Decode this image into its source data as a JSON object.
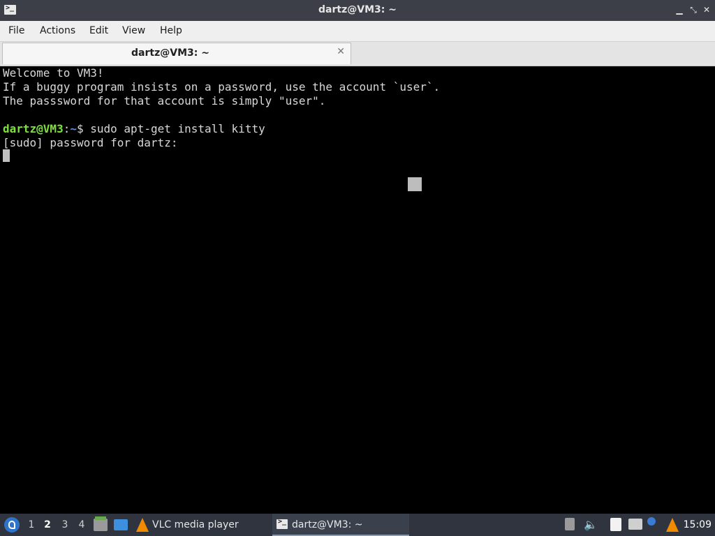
{
  "window": {
    "title": "dartz@VM3: ~",
    "minimize_glyph": "▁",
    "maximize_glyph": "⤡",
    "close_glyph": "✕"
  },
  "menu": {
    "items": [
      "File",
      "Actions",
      "Edit",
      "View",
      "Help"
    ]
  },
  "tab": {
    "label": "dartz@VM3: ~",
    "close_glyph": "✕"
  },
  "terminal": {
    "lines": [
      "Welcome to VM3!",
      "If a buggy program insists on a password, use the account `user`.",
      "The passsword for that account is simply \"user\".",
      ""
    ],
    "prompt": {
      "user_host": "dartz@VM3",
      "separator": ":",
      "path": "~",
      "symbol": "$",
      "command": " sudo apt-get install kitty"
    },
    "sudo_line": "[sudo] password for dartz:",
    "colors": {
      "background": "#000000",
      "text": "#d8d8d8",
      "prompt_user": "#7ee03a",
      "prompt_path": "#5a8ee8"
    }
  },
  "taskbar": {
    "workspaces": [
      {
        "label": "1",
        "active": false
      },
      {
        "label": "2",
        "active": true
      },
      {
        "label": "3",
        "active": false
      },
      {
        "label": "4",
        "active": false
      }
    ],
    "tasks": [
      {
        "label": "VLC media player",
        "icon": "vlc-icon"
      },
      {
        "label": "dartz@VM3: ~",
        "icon": "terminal-icon"
      }
    ],
    "tray_icons": [
      "updates-icon",
      "volume-icon",
      "clipboard-icon",
      "network-icon",
      "vlc-tray-icon"
    ],
    "clock": "15:09",
    "colors": {
      "background": "#2f343f",
      "vlc_orange": "#f08a00"
    }
  }
}
